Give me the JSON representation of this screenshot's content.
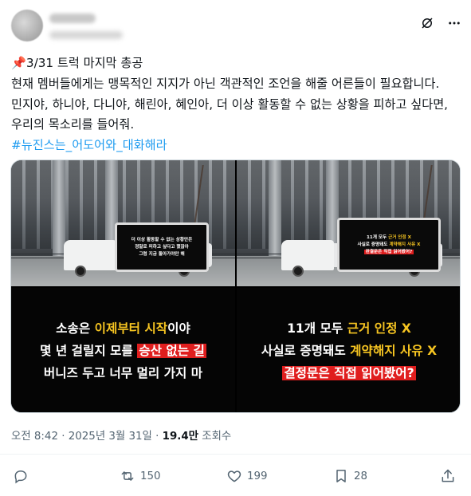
{
  "post": {
    "text": {
      "line1": "📌3/31 트럭 마지막 총공",
      "line2": "현재 멤버들에게는 맹목적인 지지가 아닌 객관적인 조언을 해줄 어른들이 필요합니다.",
      "line3": "민지야, 하니야, 다니야, 해린아, 혜인아, 더 이상 활동할 수 없는 상황을 피하고 싶다면,",
      "line4": "우리의 목소리를 들어줘.",
      "hashtag": "#뉴진스는_어도어와_대화해라"
    },
    "header_icons": [
      "grok-icon",
      "more-icon"
    ],
    "media": {
      "photo1_screen": {
        "line1": "더 이상 활동할 수 없는 상황만은",
        "line2": "정말로 피하고 싶다고 했잖아",
        "line3": "그럼 지금 돌아가야만 해"
      },
      "photo2_screen": {
        "line1a": "11개 모두 ",
        "line1b": "근거 인정 X",
        "line2a": "사실로 증명돼도 ",
        "line2b": "계약해지 사유 X",
        "line3": "판결문은 직접 읽어봤어?"
      },
      "graphic1": {
        "line1a": "소송은 ",
        "line1b": "이제부터 시작",
        "line1c": "이야",
        "line2a": "몇 년 걸릴지 모를 ",
        "line2b": "승산 없는 길",
        "line3": "버니즈 두고 너무 멀리 가지 마"
      },
      "graphic2": {
        "line1a": "11개 모두 ",
        "line1b": "근거 인정 X",
        "line2a": "사실로 증명돼도 ",
        "line2b": "계약해지 사유 X",
        "line3": "결정문은 직접 읽어봤어?"
      }
    },
    "meta": {
      "time": "오전 8:42",
      "separator": " · ",
      "date": "2025년 3월 31일",
      "views_count": "19.4만",
      "views_label": " 조회수"
    },
    "actions": {
      "reply_count": "",
      "retweet_count": "150",
      "like_count": "199",
      "bookmark_count": "28"
    }
  },
  "colors": {
    "link": "#1d9bf0",
    "text": "#0f1419",
    "secondary": "#536471",
    "highlight_yellow": "#f7c521",
    "highlight_red": "#e01e1e"
  }
}
